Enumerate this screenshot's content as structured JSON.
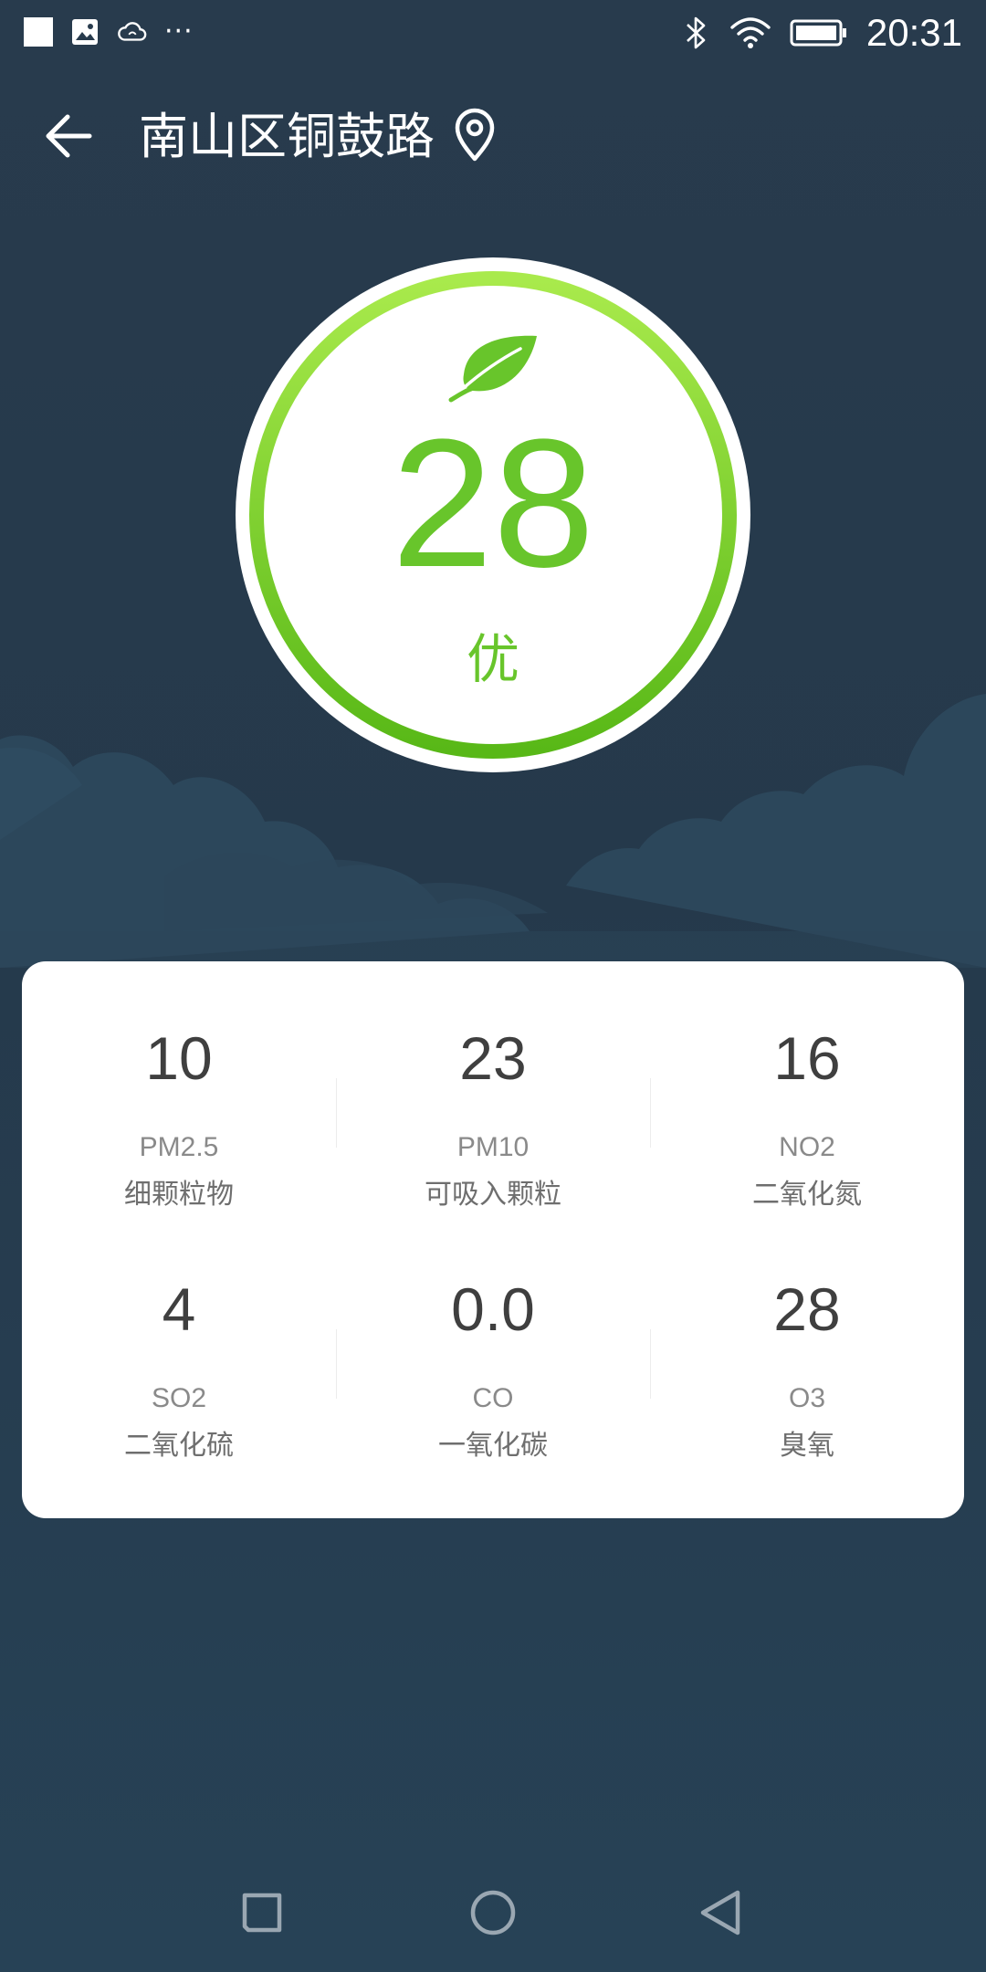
{
  "status_bar": {
    "time": "20:31",
    "left_icons": [
      "notification-square-icon",
      "image-icon",
      "cloud-icon",
      "more-dots-icon"
    ],
    "more_dots": "···",
    "right_icons": [
      "bluetooth-icon",
      "wifi-icon",
      "battery-icon"
    ]
  },
  "header": {
    "location": "南山区铜鼓路",
    "back_icon": "back-arrow-icon",
    "pin_icon": "location-pin-icon"
  },
  "aqi": {
    "value": "28",
    "level": "优",
    "ring_color": "#68c52b",
    "icon": "leaf-icon"
  },
  "pollutants": [
    {
      "value": "10",
      "code": "PM2.5",
      "name": "细颗粒物"
    },
    {
      "value": "23",
      "code": "PM10",
      "name": "可吸入颗粒"
    },
    {
      "value": "16",
      "code": "NO2",
      "name": "二氧化氮"
    },
    {
      "value": "4",
      "code": "SO2",
      "name": "二氧化硫"
    },
    {
      "value": "0.0",
      "code": "CO",
      "name": "一氧化碳"
    },
    {
      "value": "28",
      "code": "O3",
      "name": "臭氧"
    }
  ],
  "nav_bar": {
    "buttons": [
      "recents-square-icon",
      "home-circle-icon",
      "back-triangle-icon"
    ]
  },
  "colors": {
    "background": "#263a4c",
    "accent_green": "#68c52b",
    "card": "#ffffff",
    "value_text": "#3f3f3f"
  }
}
